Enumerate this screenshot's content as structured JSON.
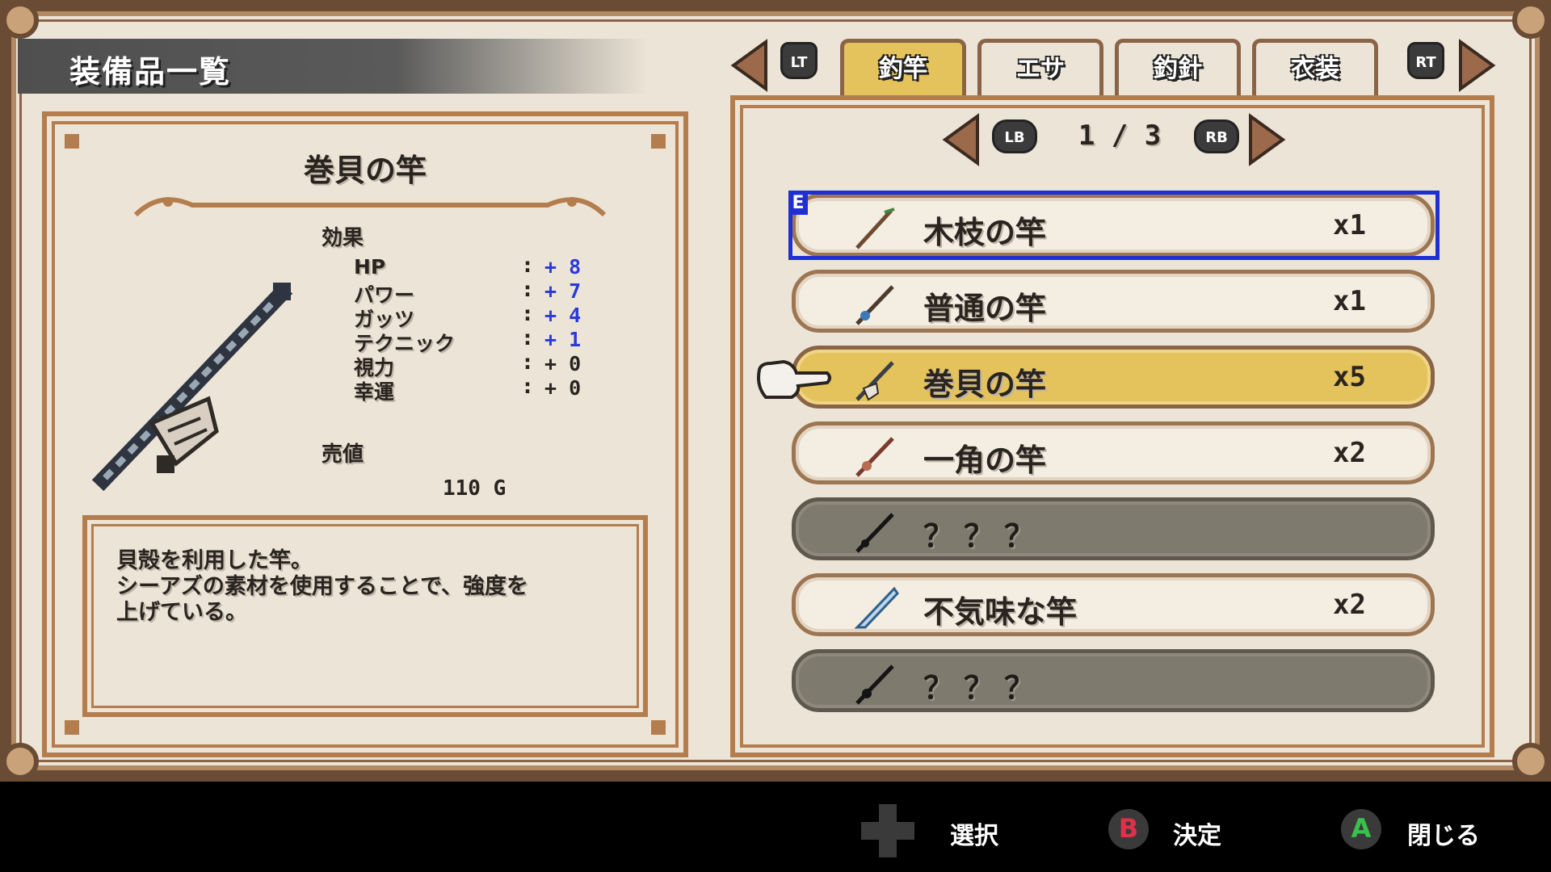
{
  "title": "装備品一覧",
  "tabs": {
    "left_trigger": "LT",
    "right_trigger": "RT",
    "items": [
      {
        "label": "釣竿",
        "active": true
      },
      {
        "label": "エサ",
        "active": false
      },
      {
        "label": "釣針",
        "active": false
      },
      {
        "label": "衣装",
        "active": false
      }
    ]
  },
  "pager": {
    "left_bumper": "LB",
    "right_bumper": "RB",
    "text": "1 / 3"
  },
  "detail": {
    "name": "巻貝の竿",
    "effect_label": "効果",
    "stats": [
      {
        "name": "HP",
        "value": "+ 8"
      },
      {
        "name": "パワー",
        "value": "+ 7"
      },
      {
        "name": "ガッツ",
        "value": "+ 4"
      },
      {
        "name": "テクニック",
        "value": "+ 1"
      },
      {
        "name": "視力",
        "value": "+ 0"
      },
      {
        "name": "幸運",
        "value": "+ 0"
      }
    ],
    "price_label": "売値",
    "price": "110 G",
    "description": [
      "貝殻を利用した竿。",
      "シーアズの素材を使用することで、強度を",
      "上げている。"
    ]
  },
  "equipped_mark": "E",
  "list": [
    {
      "name": "木枝の竿",
      "qty": "x1",
      "state": "equipped",
      "icon": "twig-rod-icon"
    },
    {
      "name": "普通の竿",
      "qty": "x1",
      "state": "normal",
      "icon": "basic-rod-icon"
    },
    {
      "name": "巻貝の竿",
      "qty": "x5",
      "state": "selected",
      "icon": "shell-rod-icon"
    },
    {
      "name": "一角の竿",
      "qty": "x2",
      "state": "normal",
      "icon": "horn-rod-icon"
    },
    {
      "name": "？？？",
      "qty": "",
      "state": "locked",
      "icon": "unknown-rod-icon"
    },
    {
      "name": "不気味な竿",
      "qty": "x2",
      "state": "normal",
      "icon": "eerie-rod-icon"
    },
    {
      "name": "？？？",
      "qty": "",
      "state": "locked",
      "icon": "unknown-rod-icon"
    }
  ],
  "hints": [
    {
      "button": "dpad",
      "label": "選択"
    },
    {
      "button": "B",
      "label": "決定",
      "color": "#e0304a"
    },
    {
      "button": "A",
      "label": "閉じる",
      "color": "#39c24a"
    }
  ]
}
